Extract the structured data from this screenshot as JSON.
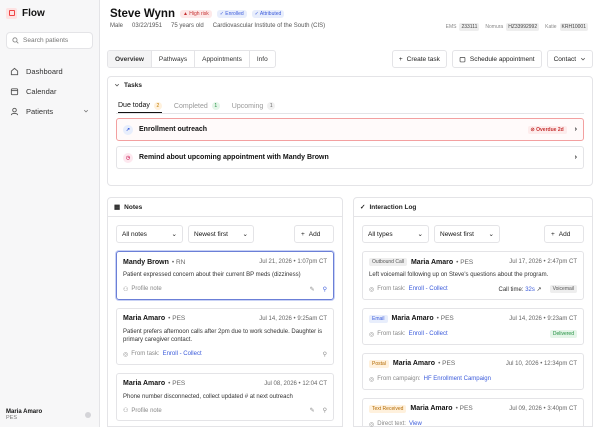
{
  "brand": {
    "name": "Flow"
  },
  "search": {
    "placeholder": "Search patients"
  },
  "nav": [
    {
      "label": "Dashboard",
      "icon": "home-icon"
    },
    {
      "label": "Calendar",
      "icon": "calendar-icon"
    },
    {
      "label": "Patients",
      "icon": "user-icon"
    }
  ],
  "user": {
    "name": "Maria Amaro",
    "role": "PES"
  },
  "patient": {
    "name": "Steve Wynn",
    "badges": [
      "High risk",
      "Enrolled",
      "Attributed"
    ],
    "sex": "Male",
    "dob": "03/22/1951",
    "age": "75 years old",
    "clinic": "Cardiovascular Institute of the South (CIS)",
    "ids": [
      {
        "label": "EMS",
        "value": "233111"
      },
      {
        "label": "Nomura",
        "value": "HZ33992992"
      },
      {
        "label": "Katie",
        "value": "KRH10001"
      }
    ]
  },
  "tabs": [
    "Overview",
    "Pathways",
    "Appointments",
    "Info"
  ],
  "actions": {
    "create_task": "Create task",
    "schedule": "Schedule appointment",
    "contact": "Contact"
  },
  "tasks": {
    "title": "Tasks",
    "tabs": [
      {
        "label": "Due today",
        "count": "2"
      },
      {
        "label": "Completed",
        "count": "1"
      },
      {
        "label": "Upcoming",
        "count": "1"
      }
    ],
    "items": [
      {
        "label": "Enrollment outreach",
        "status": "Overdue 2d"
      },
      {
        "label": "Remind about upcoming appointment with Mandy Brown",
        "status": ""
      }
    ]
  },
  "notes": {
    "title": "Notes",
    "filter": "All notes",
    "sort": "Newest first",
    "add": "Add",
    "items": [
      {
        "author": "Mandy Brown",
        "role": "RN",
        "date": "Jul 21, 2026 • 1:07pm CT",
        "text": "Patient expressed concern about their current BP meds (dizziness)",
        "footer": "Profile note",
        "link": ""
      },
      {
        "author": "Maria Amaro",
        "role": "PES",
        "date": "Jul 14, 2026 • 9:25am CT",
        "text": "Patient prefers afternoon calls after 2pm due to work schedule. Daughter is primary caregiver contact.",
        "footer": "From task:",
        "link": "Enroll - Collect"
      },
      {
        "author": "Maria Amaro",
        "role": "PES",
        "date": "Jul 08, 2026 • 12:04 CT",
        "text": "Phone number disconnected, collect updated # at next outreach",
        "footer": "Profile note",
        "link": ""
      }
    ]
  },
  "interactions": {
    "title": "Interaction Log",
    "filter": "All types",
    "sort": "Newest first",
    "add": "Add",
    "items": [
      {
        "type": "Outbound Call",
        "author": "Maria Amaro",
        "role": "PES",
        "date": "Jul 17, 2026 • 2:47pm CT",
        "text": "Left voicemail following up on Steve's questions about the program.",
        "footer": "From task:",
        "link": "Enroll - Collect",
        "extra": "Call time:",
        "extra_link": "32s",
        "status": "Voicemail"
      },
      {
        "type": "Email",
        "author": "Maria Amaro",
        "role": "PES",
        "date": "Jul 14, 2026 • 9:23am CT",
        "text": "",
        "footer": "From task:",
        "link": "Enroll - Collect",
        "extra": "",
        "extra_link": "",
        "status": "Delivered"
      },
      {
        "type": "Postal",
        "author": "Maria Amaro",
        "role": "PES",
        "date": "Jul 10, 2026 • 12:34pm CT",
        "text": "",
        "footer": "From campaign:",
        "link": "HF Enrollment Campaign",
        "extra": "",
        "extra_link": "",
        "status": ""
      },
      {
        "type": "Text Received",
        "author": "Maria Amaro",
        "role": "PES",
        "date": "Jul 09, 2026 • 3:40pm CT",
        "text": "",
        "footer": "Direct text:",
        "link": "View",
        "extra": "",
        "extra_link": "",
        "status": ""
      }
    ]
  }
}
